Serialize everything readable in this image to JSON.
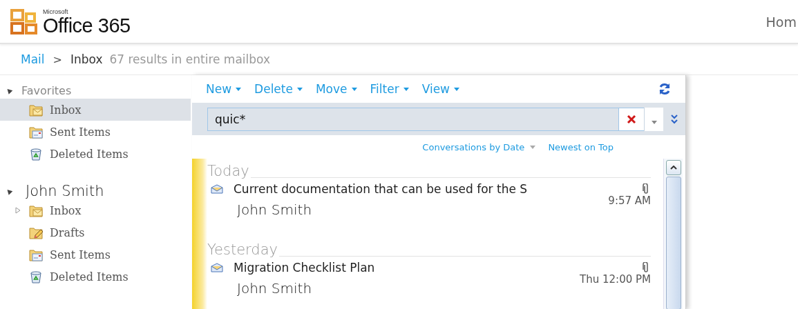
{
  "header": {
    "logo": {
      "brand": "Microsoft",
      "product": "Office 365"
    },
    "nav_link": "Hom"
  },
  "breadcrumb": {
    "root": "Mail",
    "separator": ">",
    "current": "Inbox",
    "result_count": "67 results in entire mailbox"
  },
  "sidebar": {
    "groups": [
      {
        "title": "Favorites",
        "expanded": true,
        "items": [
          {
            "label": "Inbox",
            "kind": "inbox",
            "selected": true,
            "expandable": false
          },
          {
            "label": "Sent Items",
            "kind": "sent",
            "selected": false,
            "expandable": false
          },
          {
            "label": "Deleted Items",
            "kind": "deleted",
            "selected": false,
            "expandable": false
          }
        ]
      },
      {
        "title": "John Smith",
        "expanded": true,
        "items": [
          {
            "label": "Inbox",
            "kind": "inbox",
            "selected": false,
            "expandable": true
          },
          {
            "label": "Drafts",
            "kind": "drafts",
            "selected": false,
            "expandable": false
          },
          {
            "label": "Sent Items",
            "kind": "sent",
            "selected": false,
            "expandable": false
          },
          {
            "label": "Deleted Items",
            "kind": "deleted",
            "selected": false,
            "expandable": false
          }
        ]
      }
    ]
  },
  "toolbar": {
    "actions": [
      "New",
      "Delete",
      "Move",
      "Filter",
      "View"
    ]
  },
  "search": {
    "value": "quic*"
  },
  "sort": {
    "arrange_by": "Conversations by Date",
    "order": "Newest on Top"
  },
  "message_groups": [
    {
      "heading": "Today",
      "messages": [
        {
          "subject": "Current documentation that can be used for the S",
          "sender": "John Smith",
          "time": "9:57 AM",
          "attachment": true
        }
      ]
    },
    {
      "heading": "Yesterday",
      "messages": [
        {
          "subject": "Migration Checklist Plan",
          "sender": "John Smith",
          "time": "Thu 12:00 PM",
          "attachment": true
        }
      ]
    }
  ]
}
